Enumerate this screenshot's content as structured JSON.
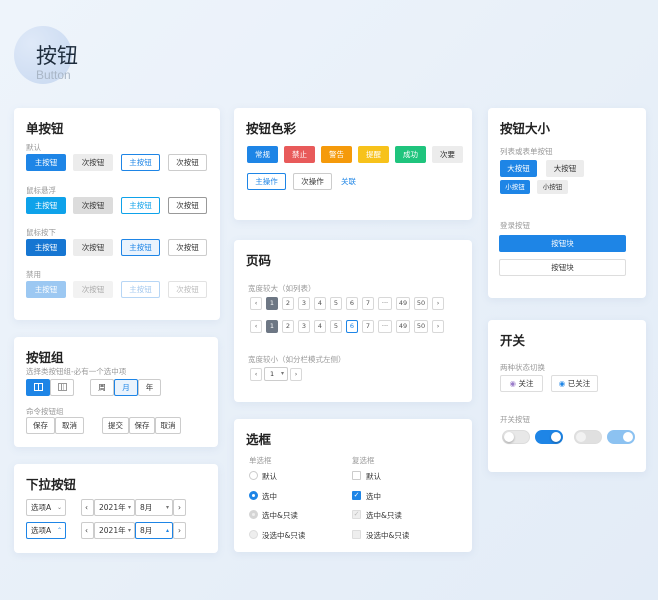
{
  "page": {
    "title": "按钮",
    "subtitle": "Button"
  },
  "single": {
    "title": "单按钮",
    "rows": [
      {
        "label": "默认",
        "primary": "主按钮",
        "secondary": "次按钮",
        "outline": "主按钮",
        "ghost": "次按钮"
      },
      {
        "label": "鼠标悬浮",
        "primary": "主按钮",
        "secondary": "次按钮",
        "outline": "主按钮",
        "ghost": "次按钮"
      },
      {
        "label": "鼠标按下",
        "primary": "主按钮",
        "secondary": "次按钮",
        "outline": "主按钮",
        "ghost": "次按钮"
      },
      {
        "label": "禁用",
        "primary": "主按钮",
        "secondary": "次按钮",
        "outline": "主按钮",
        "ghost": "次按钮"
      }
    ]
  },
  "group": {
    "title": "按钮组",
    "select_label": "选择类按钮组-必有一个选中项",
    "period": [
      "周",
      "月",
      "年"
    ],
    "cmd_label": "命令按钮组",
    "cmd1": [
      "保存",
      "取消"
    ],
    "cmd2": [
      "提交",
      "保存",
      "取消"
    ]
  },
  "dropdown": {
    "title": "下拉按钮",
    "opt": "选项A",
    "year": "2021年",
    "month": "8月"
  },
  "colors": {
    "title": "按钮色彩",
    "buttons": [
      "常规",
      "禁止",
      "警告",
      "提醒",
      "成功",
      "次要"
    ],
    "primary_op": "主操作",
    "secondary_op": "次操作",
    "link": "关联",
    "palette": {
      "normal": "#1e85e6",
      "forbid": "#e85a5a",
      "warn": "#f59a0b",
      "remind": "#f7c21b",
      "success": "#1fc47d",
      "minor": "#e8e8e8"
    }
  },
  "pager": {
    "title": "页码",
    "wide_label": "宽度较大（如列表）",
    "pages": [
      "1",
      "2",
      "3",
      "4",
      "5",
      "6",
      "7",
      "···",
      "49",
      "50"
    ],
    "narrow_label": "宽度较小（如分栏模式左侧）",
    "narrow_value": "1"
  },
  "checks": {
    "title": "选框",
    "radio_label": "单选框",
    "check_label": "复选框",
    "items": [
      "默认",
      "选中",
      "选中&只读",
      "没选中&只读"
    ]
  },
  "sizes": {
    "title": "按钮大小",
    "list_label": "列表或表单按钮",
    "big": "大按钮",
    "small": "小按钮",
    "login_label": "登录按钮",
    "block": "按钮块"
  },
  "switch": {
    "title": "开关",
    "two_state_label": "两种状态切换",
    "follow": "关注",
    "followed": "已关注",
    "switch_label": "开关按钮"
  }
}
